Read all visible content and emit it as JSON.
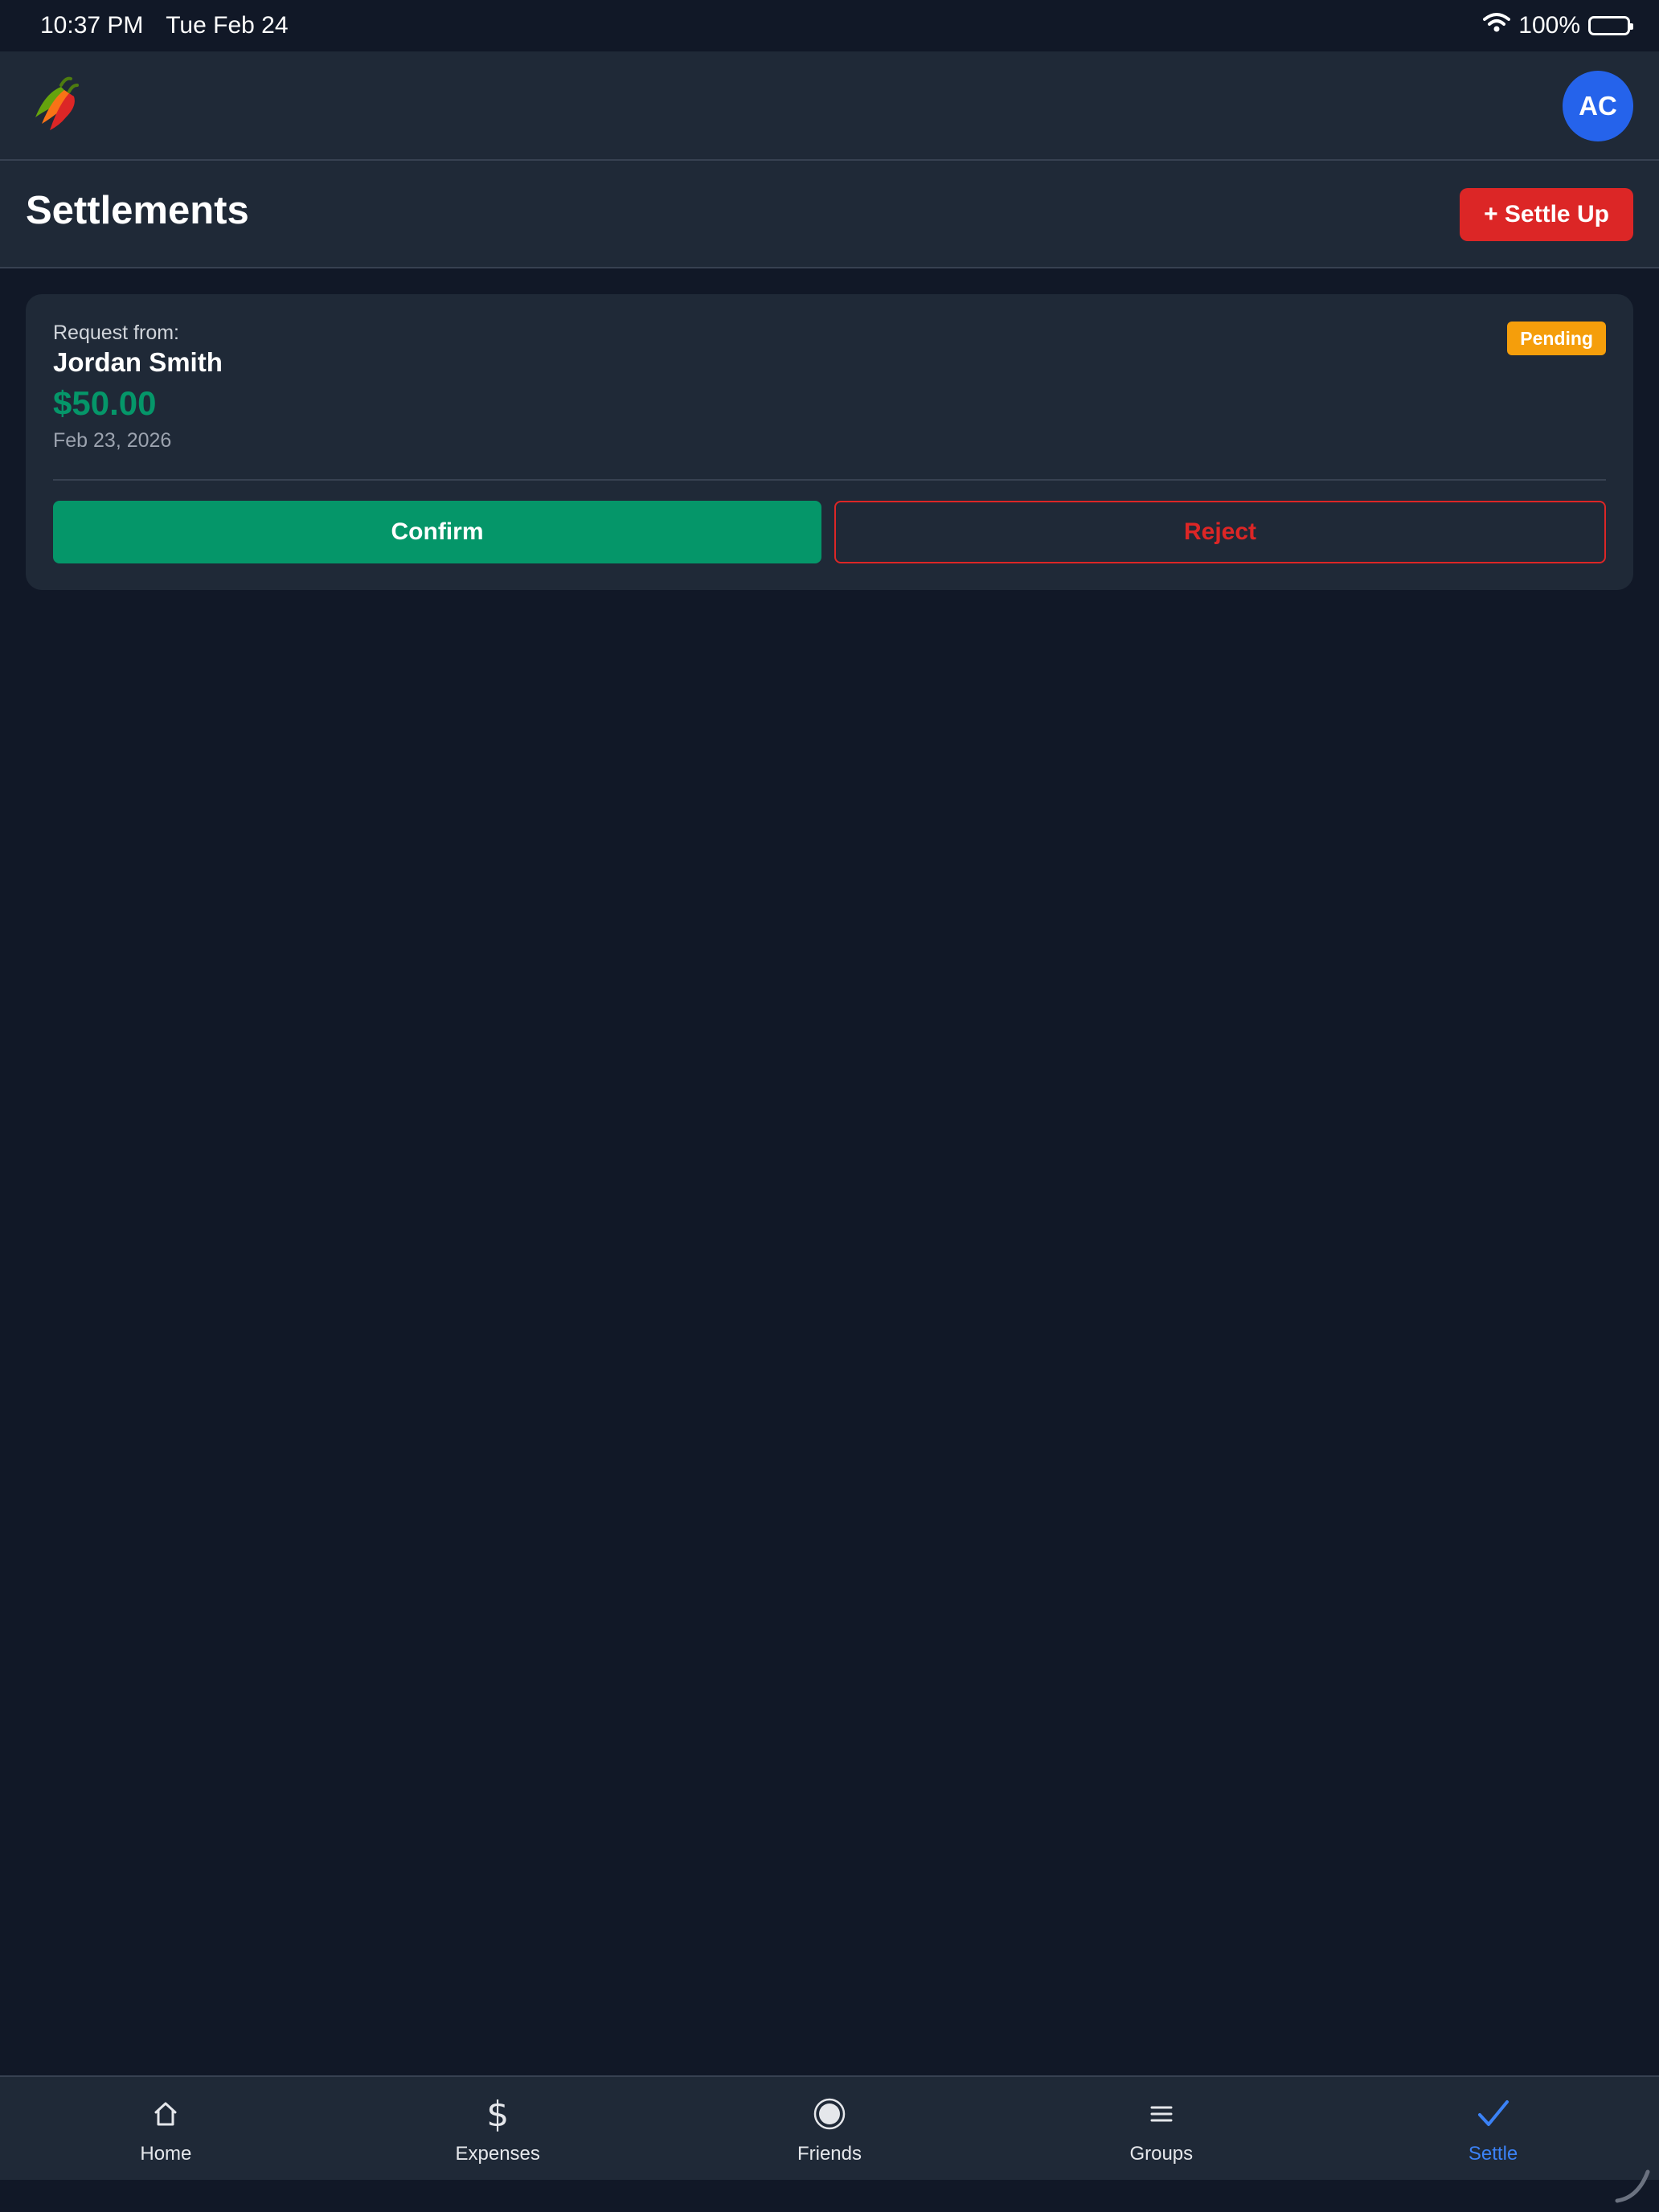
{
  "status_bar": {
    "time": "10:37 PM",
    "date": "Tue Feb 24",
    "battery": "100%"
  },
  "header": {
    "avatar_initials": "AC"
  },
  "page": {
    "title": "Settlements",
    "settle_up_label": "+ Settle Up"
  },
  "settlement": {
    "label": "Request from:",
    "name": "Jordan Smith",
    "amount": "$50.00",
    "date": "Feb 23, 2026",
    "status": "Pending",
    "confirm_label": "Confirm",
    "reject_label": "Reject"
  },
  "nav": {
    "items": [
      {
        "label": "Home",
        "icon": "home-icon"
      },
      {
        "label": "Expenses",
        "icon": "dollar-icon"
      },
      {
        "label": "Friends",
        "icon": "friends-icon"
      },
      {
        "label": "Groups",
        "icon": "groups-icon"
      },
      {
        "label": "Settle",
        "icon": "check-icon"
      }
    ],
    "active": "Settle"
  },
  "colors": {
    "background": "#111827",
    "surface": "#1f2937",
    "accent_blue": "#2563eb",
    "danger_red": "#dc2626",
    "success_green": "#059669",
    "pending_amber": "#f59e0b"
  }
}
